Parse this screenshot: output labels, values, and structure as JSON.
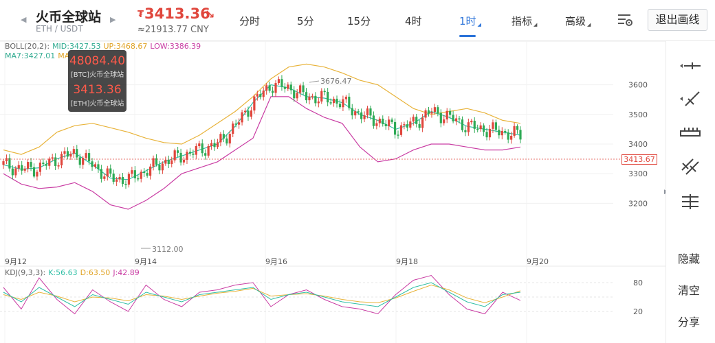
{
  "header": {
    "pair_title": "火币全球站",
    "pair_sub": "ETH / USDT",
    "currency_symbol": "₮",
    "price": "3413.36",
    "price_arrow": "↘",
    "price_cny": "≈21913.77 CNY",
    "timeframes": [
      {
        "label": "分时",
        "dropdown": false
      },
      {
        "label": "5分",
        "dropdown": false
      },
      {
        "label": "15分",
        "dropdown": false
      },
      {
        "label": "4时",
        "dropdown": false
      },
      {
        "label": "1时",
        "dropdown": true,
        "active": true
      },
      {
        "label": "指标",
        "dropdown": true
      },
      {
        "label": "高级",
        "dropdown": true
      }
    ],
    "exit_label": "退出画线"
  },
  "legend": {
    "boll_name": "BOLL(20,2):",
    "boll_mid": "MID:3427.53",
    "boll_up": "UP:3468.67",
    "boll_low": "LOW:3386.39",
    "ma7": "MA7:3427.01",
    "ma_partial": "MA",
    "kdj_name": "KDJ(9,3,3):",
    "kdj_k": "K:56.63",
    "kdj_d": "D:63.50",
    "kdj_j": "J:42.89"
  },
  "tooltip": {
    "btc_price": "48084.40",
    "btc_label": "[BTC]火币全球站",
    "eth_price": "3413.36",
    "eth_label": "[ETH]火币全球站"
  },
  "chart_labels": {
    "high_marker": "3676.47",
    "low_marker": "3112.00",
    "current_tag": "3413.67",
    "y_ticks": [
      "3600",
      "3500",
      "3400",
      "3300",
      "3200"
    ],
    "x_ticks": [
      "9月12",
      "9月14",
      "9月16",
      "9月18",
      "9月20"
    ],
    "kdj_ticks": [
      "80",
      "20"
    ]
  },
  "right_bar": {
    "tools": [
      "horizontal-line-icon",
      "trend-line-icon",
      "ruler-icon",
      "parallel-lines-icon",
      "channel-lines-icon"
    ],
    "hide_label": "隐藏",
    "clear_label": "清空",
    "share_label": "分享"
  },
  "colors": {
    "up": "#e0463c",
    "down": "#2eaa55",
    "accent": "#2b73d9",
    "boll_mid": "#2ebfa5",
    "boll_up": "#e8b33a",
    "boll_low": "#c93ca3"
  },
  "chart_data": {
    "type": "candlestick",
    "price_range": [
      3112,
      3676.47
    ],
    "boll_upper": [
      3380,
      3365,
      3390,
      3440,
      3462,
      3470,
      3455,
      3440,
      3420,
      3405,
      3400,
      3430,
      3470,
      3510,
      3560,
      3620,
      3660,
      3670,
      3660,
      3640,
      3615,
      3600,
      3560,
      3520,
      3500,
      3510,
      3520,
      3505,
      3480,
      3470
    ],
    "boll_mid": [
      3330,
      3315,
      3320,
      3350,
      3370,
      3330,
      3285,
      3280,
      3310,
      3340,
      3360,
      3380,
      3400,
      3460,
      3540,
      3600,
      3590,
      3560,
      3555,
      3540,
      3500,
      3480,
      3450,
      3470,
      3510,
      3490,
      3460,
      3450,
      3440,
      3430
    ],
    "boll_lower": [
      3300,
      3265,
      3250,
      3255,
      3270,
      3240,
      3195,
      3180,
      3210,
      3250,
      3300,
      3320,
      3340,
      3380,
      3420,
      3560,
      3560,
      3520,
      3490,
      3470,
      3390,
      3340,
      3350,
      3380,
      3400,
      3400,
      3390,
      3380,
      3380,
      3390
    ],
    "kdj_k": [
      60,
      40,
      70,
      50,
      30,
      55,
      45,
      35,
      60,
      50,
      40,
      55,
      60,
      65,
      70,
      45,
      55,
      60,
      50,
      40,
      35,
      30,
      50,
      70,
      80,
      60,
      40,
      30,
      55,
      60
    ],
    "kdj_d": [
      55,
      45,
      60,
      52,
      40,
      50,
      48,
      42,
      55,
      52,
      45,
      52,
      58,
      62,
      68,
      52,
      55,
      57,
      52,
      45,
      40,
      38,
      48,
      62,
      75,
      65,
      48,
      38,
      50,
      63
    ],
    "kdj_j": [
      70,
      25,
      90,
      45,
      15,
      65,
      40,
      20,
      75,
      45,
      30,
      60,
      65,
      75,
      80,
      30,
      55,
      65,
      45,
      30,
      25,
      15,
      55,
      85,
      95,
      55,
      25,
      15,
      60,
      43
    ]
  }
}
